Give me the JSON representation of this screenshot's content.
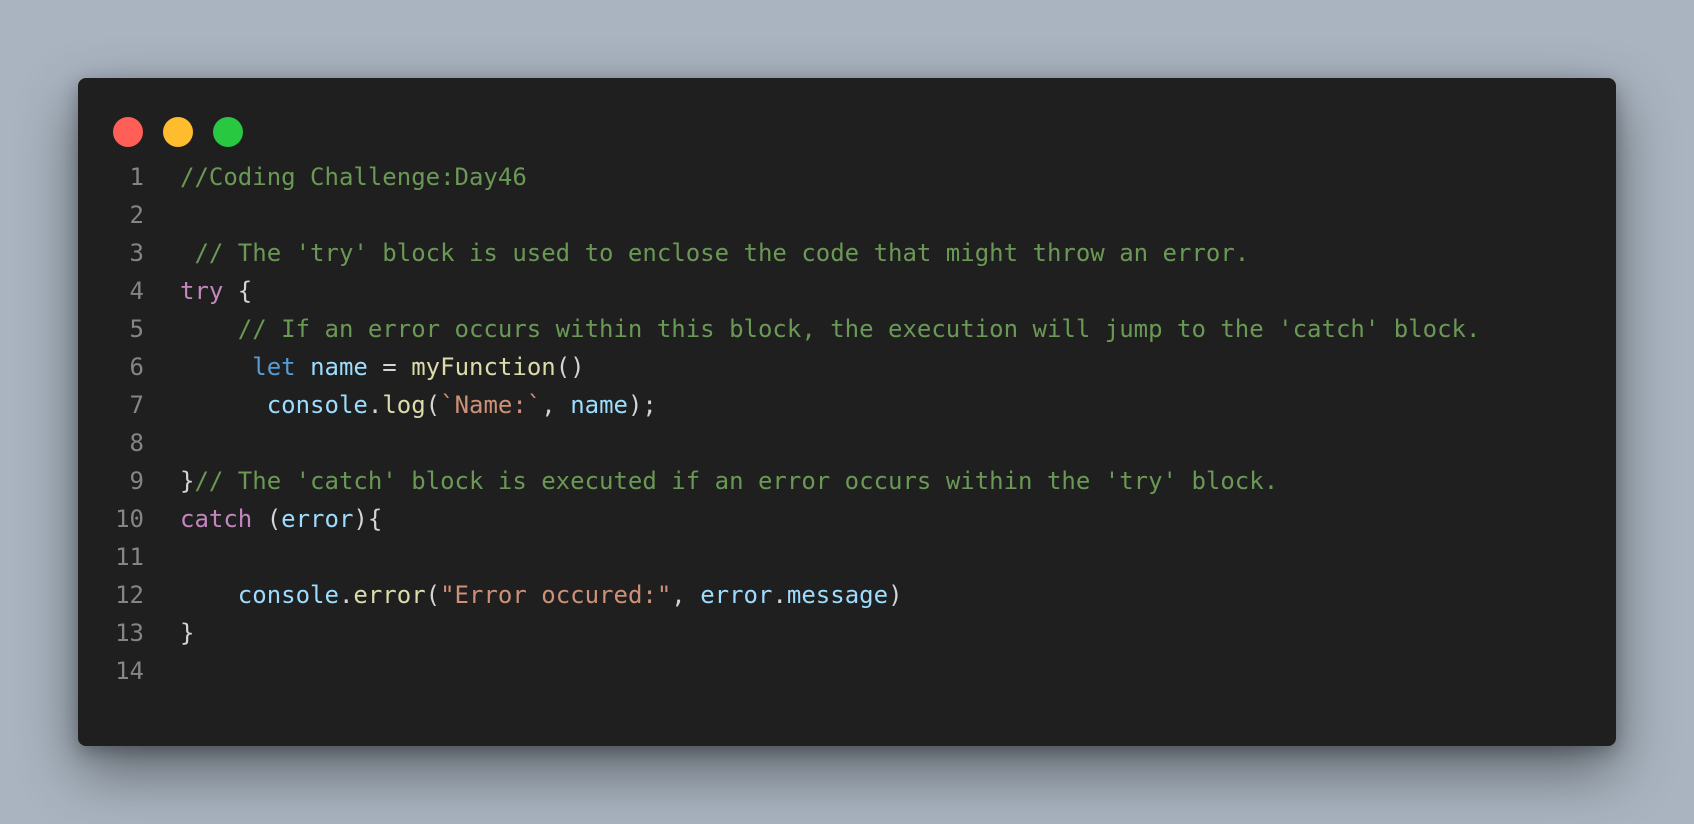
{
  "window_controls": {
    "close_color": "#ff5f57",
    "minimize_color": "#febc2e",
    "maximize_color": "#28c840"
  },
  "colors": {
    "comment": "#6a9955",
    "control": "#c586c0",
    "keyword": "#569cd6",
    "variable": "#9cdcfe",
    "function": "#dcdcaa",
    "string": "#ce9178",
    "plain": "#d4d4d4",
    "line_number": "#858585"
  },
  "code_lines": [
    {
      "number": "1",
      "tokens": [
        {
          "text": "//Coding Challenge:Day46",
          "type": "comment"
        }
      ]
    },
    {
      "number": "2",
      "tokens": []
    },
    {
      "number": "3",
      "tokens": [
        {
          "text": " // The 'try' block is used to enclose the code that might throw an error.",
          "type": "comment"
        }
      ]
    },
    {
      "number": "4",
      "tokens": [
        {
          "text": "try",
          "type": "control"
        },
        {
          "text": " {",
          "type": "plain"
        }
      ]
    },
    {
      "number": "5",
      "tokens": [
        {
          "text": "    // If an error occurs within this block, the execution will jump to the 'catch' block.",
          "type": "comment"
        }
      ]
    },
    {
      "number": "6",
      "tokens": [
        {
          "text": "     ",
          "type": "plain"
        },
        {
          "text": "let",
          "type": "keyword"
        },
        {
          "text": " ",
          "type": "plain"
        },
        {
          "text": "name",
          "type": "variable"
        },
        {
          "text": " = ",
          "type": "plain"
        },
        {
          "text": "myFunction",
          "type": "function"
        },
        {
          "text": "()",
          "type": "plain"
        }
      ]
    },
    {
      "number": "7",
      "tokens": [
        {
          "text": "      ",
          "type": "plain"
        },
        {
          "text": "console",
          "type": "variable"
        },
        {
          "text": ".",
          "type": "plain"
        },
        {
          "text": "log",
          "type": "function"
        },
        {
          "text": "(",
          "type": "plain"
        },
        {
          "text": "`Name:`",
          "type": "string"
        },
        {
          "text": ", ",
          "type": "plain"
        },
        {
          "text": "name",
          "type": "variable"
        },
        {
          "text": ");",
          "type": "plain"
        }
      ]
    },
    {
      "number": "8",
      "tokens": []
    },
    {
      "number": "9",
      "tokens": [
        {
          "text": "}",
          "type": "plain"
        },
        {
          "text": "// The 'catch' block is executed if an error occurs within the 'try' block.",
          "type": "comment"
        }
      ]
    },
    {
      "number": "10",
      "tokens": [
        {
          "text": "catch",
          "type": "control"
        },
        {
          "text": " (",
          "type": "plain"
        },
        {
          "text": "error",
          "type": "variable"
        },
        {
          "text": "){",
          "type": "plain"
        }
      ]
    },
    {
      "number": "11",
      "tokens": []
    },
    {
      "number": "12",
      "tokens": [
        {
          "text": "    ",
          "type": "plain"
        },
        {
          "text": "console",
          "type": "variable"
        },
        {
          "text": ".",
          "type": "plain"
        },
        {
          "text": "error",
          "type": "function"
        },
        {
          "text": "(",
          "type": "plain"
        },
        {
          "text": "\"Error occured:\"",
          "type": "string"
        },
        {
          "text": ", ",
          "type": "plain"
        },
        {
          "text": "error",
          "type": "variable"
        },
        {
          "text": ".",
          "type": "plain"
        },
        {
          "text": "message",
          "type": "variable"
        },
        {
          "text": ")",
          "type": "plain"
        }
      ]
    },
    {
      "number": "13",
      "tokens": [
        {
          "text": "}",
          "type": "plain"
        }
      ]
    },
    {
      "number": "14",
      "tokens": []
    }
  ]
}
